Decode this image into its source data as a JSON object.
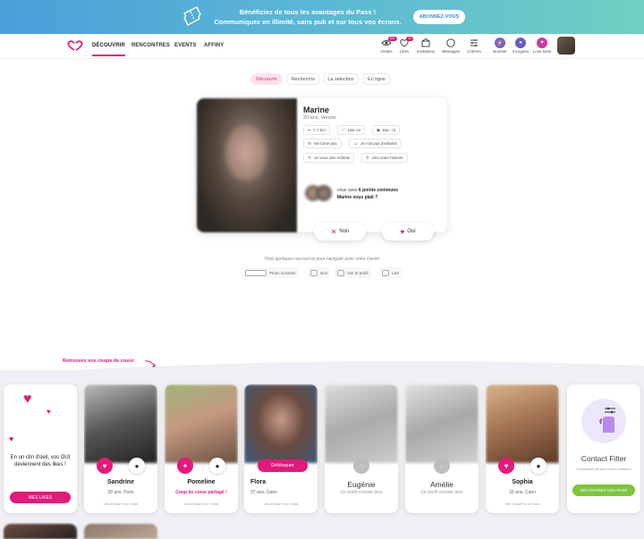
{
  "banner": {
    "line1": "Bénéficiez de tous les avantages du Pass !",
    "line2": "Communiquez en illimité, sans pub et sur tous vos écrans.",
    "button": "ABONNEZ-VOUS"
  },
  "nav": {
    "links": [
      "DÉCOUVRIR",
      "RENCONTRES",
      "EVENTS",
      "AFFINY"
    ],
    "icons": [
      {
        "label": "Visites",
        "badge": "99+",
        "icon": "eye-icon"
      },
      {
        "label": "Likes",
        "badge": "12",
        "icon": "heart-icon"
      },
      {
        "label": "Invitations",
        "badge": "",
        "icon": "invitation-icon"
      },
      {
        "label": "Messages",
        "badge": "",
        "icon": "message-icon"
      },
      {
        "label": "Critères",
        "badge": "",
        "icon": "filters-icon"
      },
      {
        "label": "Booster",
        "badge": "",
        "icon": "booster-icon"
      },
      {
        "label": "Incognito",
        "badge": "",
        "icon": "incognito-icon"
      },
      {
        "label": "Love Note",
        "badge": "",
        "icon": "love-note-icon"
      }
    ],
    "accent": "#e3197b"
  },
  "tabs": [
    "Découvrir",
    "Recherche",
    "La sélection",
    "En ligne"
  ],
  "profile": {
    "name": "Marine",
    "sub": "20 ans, Verson",
    "chips": [
      {
        "icon": "location-icon",
        "text": "À 7 km"
      },
      {
        "icon": "ruler-icon",
        "text": "169 cm"
      },
      {
        "icon": "graduation-icon",
        "text": "Bac +3"
      },
      {
        "icon": "no-smoking-icon",
        "text": "Ne fume pas"
      },
      {
        "icon": "kids-icon",
        "text": "Je n'ai pas d'enfants"
      },
      {
        "icon": "family-icon",
        "text": "Je veux des enfants"
      },
      {
        "icon": "search-icon",
        "text": "Une vraie histoire"
      }
    ],
    "common_line1": "vous avez ",
    "common_count": "6 points communs",
    "common_line2": "Marine vous plait ?",
    "no_label": "Non",
    "yes_label": "Oui"
  },
  "shortcuts": {
    "hint": "Voici quelques raccourcis pour naviguer avec votre clavier",
    "keys": [
      "Photo suivante",
      "Non",
      "Voir le profil",
      "Like"
    ]
  },
  "coups": {
    "title": "Retrouvez vos coups de coeur",
    "first_message": "En un clin d'oeil, vos OUI deviennent des likes !",
    "first_button": "MES LIKES",
    "profiles": [
      {
        "name": "Sandrine",
        "info": "30 ans, Paris",
        "last": "Lien envoyé il y a 4 mois"
      },
      {
        "name": "Pomeline",
        "info": "Coup de coeur partagé !",
        "last": "Lien envoyé il y a 4 mois"
      },
      {
        "name": "Flora",
        "info": "37 ans, Caen",
        "last": "Lien envoyé il y a 4 mois",
        "button": "Débloquer"
      },
      {
        "name": "Eugénie",
        "info": "Ce profil n'existe plus",
        "last": ""
      },
      {
        "name": "Amélie",
        "info": "Ce profil n'existe plus",
        "last": ""
      },
      {
        "name": "Sophia",
        "info": "33 ans, Caen",
        "last": "Lien envoyé il y a 4 mois"
      }
    ],
    "contact_filter": {
      "title": "Contact Filter",
      "sub": "Choisissez qui peut vous contacter",
      "button": "DÉCOUVREZ NOS PASS"
    }
  }
}
